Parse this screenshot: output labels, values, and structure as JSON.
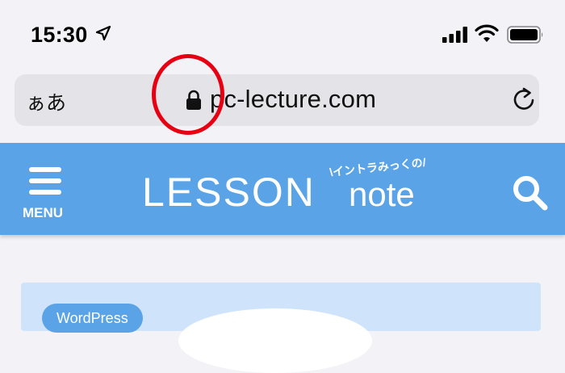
{
  "status_bar": {
    "time": "15:30",
    "icons": [
      "location-arrow-icon",
      "signal-icon",
      "wifi-icon",
      "battery-icon"
    ]
  },
  "address_bar": {
    "aa_label": "ぁあ",
    "url": "pc-lecture.com",
    "icons": [
      "lock-icon",
      "reload-icon"
    ]
  },
  "site_header": {
    "menu_label": "MENU",
    "logo_main": "LESSON",
    "logo_note": "note",
    "logo_tagline": "\\イントラみっくの/",
    "background_color": "#5aa3e6",
    "icons": [
      "menu-icon",
      "search-icon"
    ]
  },
  "content": {
    "category_badge": "WordPress"
  },
  "annotation": {
    "color": "#e60012"
  }
}
